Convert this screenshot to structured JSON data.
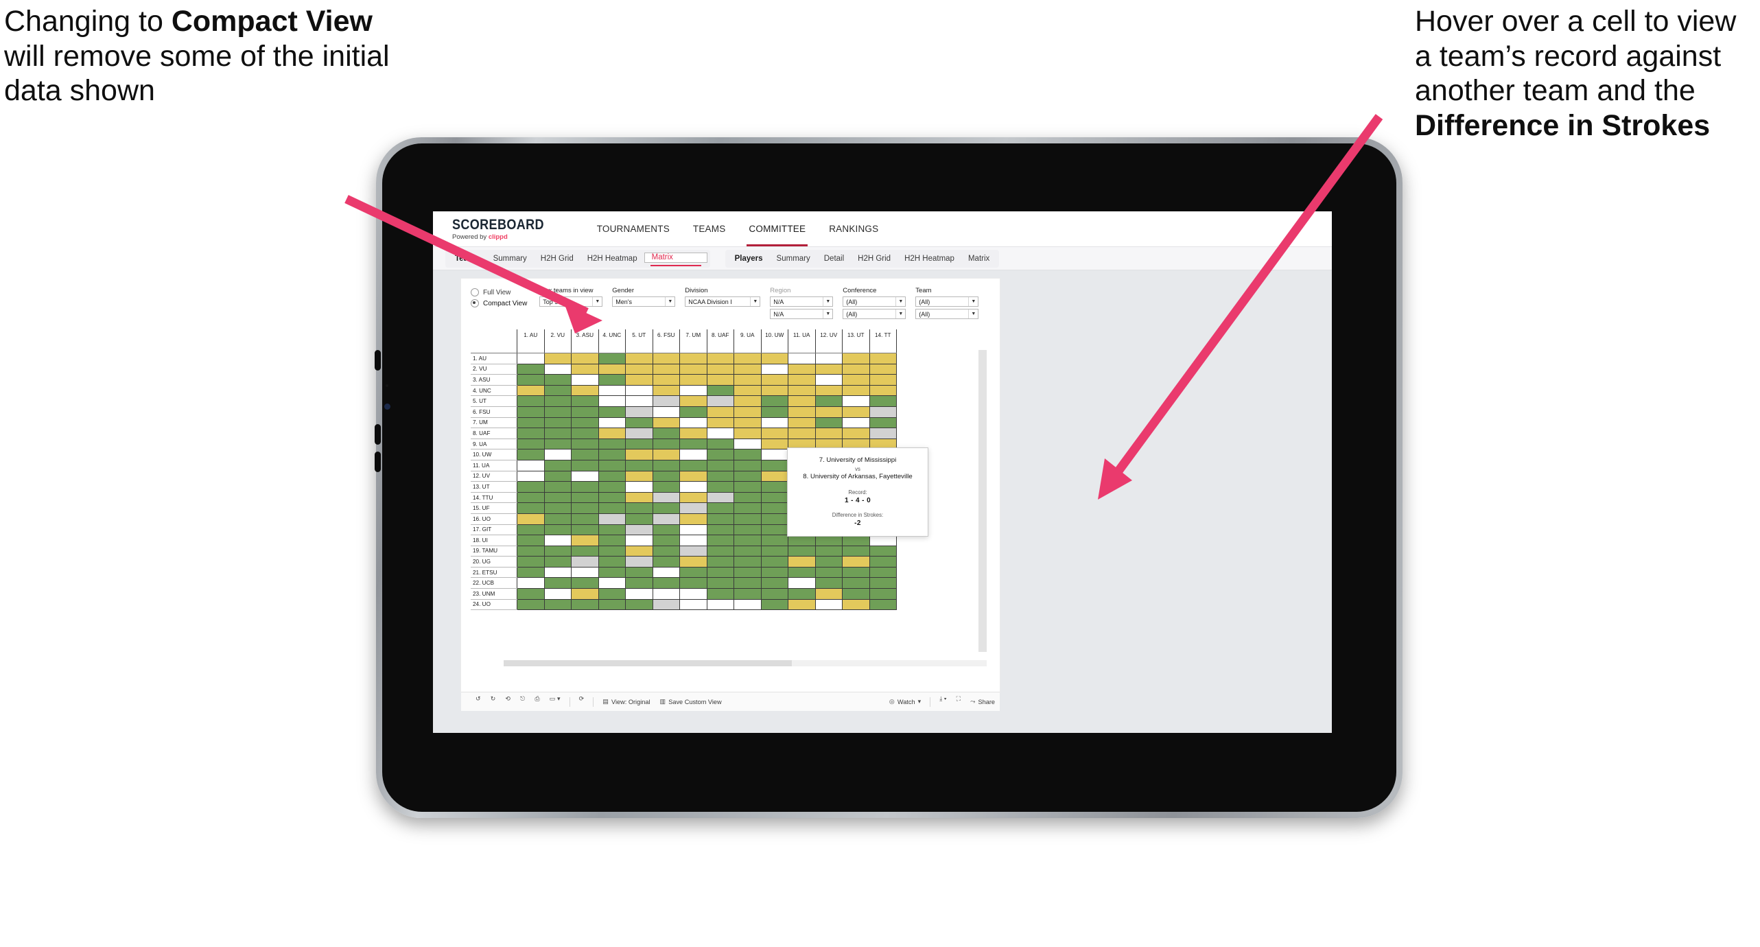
{
  "annotations": {
    "left": {
      "pre": "Changing to ",
      "bold": "Compact View",
      "post": " will remove some of the initial data shown"
    },
    "right": {
      "pre": "Hover over a cell to view a team’s record against another team and the ",
      "bold": "Difference in Strokes",
      "post": ""
    },
    "arrow_color": "#ea3a6d"
  },
  "app": {
    "logo": {
      "main": "SCOREBOARD",
      "powered": "Powered by ",
      "brand": "clippd"
    },
    "topnav": [
      {
        "label": "TOURNAMENTS",
        "active": false
      },
      {
        "label": "TEAMS",
        "active": false
      },
      {
        "label": "COMMITTEE",
        "active": true
      },
      {
        "label": "RANKINGS",
        "active": false
      }
    ],
    "subnav": {
      "teams_group": {
        "heading": "Teams",
        "items": [
          "Summary",
          "H2H Grid",
          "H2H Heatmap",
          "Matrix"
        ],
        "selected": "Matrix"
      },
      "players_group": {
        "heading": "Players",
        "items": [
          "Summary",
          "Detail",
          "H2H Grid",
          "H2H Heatmap",
          "Matrix"
        ],
        "selected": ""
      }
    }
  },
  "filters": {
    "view_mode": {
      "options": [
        "Full View",
        "Compact View"
      ],
      "selected": "Compact View"
    },
    "max_teams": {
      "label": "Max teams in view",
      "value": "Top 50"
    },
    "gender": {
      "label": "Gender",
      "value": "Men's"
    },
    "division": {
      "label": "Division",
      "value": "NCAA Division I"
    },
    "region": {
      "label": "Region",
      "value1": "N/A",
      "value2": "N/A"
    },
    "conference": {
      "label": "Conference",
      "value1": "(All)",
      "value2": "(All)"
    },
    "team": {
      "label": "Team",
      "value1": "(All)",
      "value2": "(All)"
    }
  },
  "matrix": {
    "columns": [
      "1. AU",
      "2. VU",
      "3. ASU",
      "4. UNC",
      "5. UT",
      "6. FSU",
      "7. UM",
      "8. UAF",
      "9. UA",
      "10. UW",
      "11. UA",
      "12. UV",
      "13. UT",
      "14. TT"
    ],
    "rows": [
      "1. AU",
      "2. VU",
      "3. ASU",
      "4. UNC",
      "5. UT",
      "6. FSU",
      "7. UM",
      "8. UAF",
      "9. UA",
      "10. UW",
      "11. UA",
      "12. UV",
      "13. UT",
      "14. TTU",
      "15. UF",
      "16. UO",
      "17. GIT",
      "18. UI",
      "19. TAMU",
      "20. UG",
      "21. ETSU",
      "22. UCB",
      "23. UNM",
      "24. UO"
    ],
    "legend": {
      "win": "#6f9f57",
      "loss": "#e3c95c",
      "none": "#ffffff",
      "tie": "#d2d2d2"
    },
    "cells": [
      [
        "n",
        "y",
        "y",
        "g",
        "y",
        "y",
        "y",
        "y",
        "y",
        "y",
        "w",
        "w",
        "y",
        "y"
      ],
      [
        "g",
        "n",
        "y",
        "y",
        "y",
        "y",
        "y",
        "y",
        "y",
        "w",
        "y",
        "y",
        "y",
        "y"
      ],
      [
        "g",
        "g",
        "n",
        "g",
        "y",
        "y",
        "y",
        "y",
        "y",
        "y",
        "y",
        "w",
        "y",
        "y"
      ],
      [
        "y",
        "g",
        "y",
        "n",
        "w",
        "y",
        "w",
        "g",
        "y",
        "y",
        "y",
        "y",
        "y",
        "y"
      ],
      [
        "g",
        "g",
        "g",
        "w",
        "n",
        "a",
        "y",
        "a",
        "y",
        "g",
        "y",
        "g",
        "w",
        "g"
      ],
      [
        "g",
        "g",
        "g",
        "g",
        "a",
        "n",
        "g",
        "y",
        "y",
        "g",
        "y",
        "y",
        "y",
        "a"
      ],
      [
        "g",
        "g",
        "g",
        "w",
        "g",
        "y",
        "n",
        "y",
        "y",
        "w",
        "y",
        "g",
        "w",
        "g"
      ],
      [
        "g",
        "g",
        "g",
        "y",
        "a",
        "g",
        "y",
        "n",
        "y",
        "y",
        "y",
        "y",
        "y",
        "a"
      ],
      [
        "g",
        "g",
        "g",
        "g",
        "g",
        "g",
        "g",
        "g",
        "n",
        "y",
        "y",
        "y",
        "y",
        "y"
      ],
      [
        "g",
        "w",
        "g",
        "g",
        "y",
        "y",
        "w",
        "g",
        "g",
        "n",
        "y",
        "y",
        "y",
        "w"
      ],
      [
        "w",
        "g",
        "g",
        "g",
        "g",
        "g",
        "g",
        "g",
        "g",
        "g",
        "n",
        "y",
        "g",
        "a"
      ],
      [
        "w",
        "g",
        "w",
        "g",
        "y",
        "g",
        "y",
        "g",
        "g",
        "y",
        "g",
        "n",
        "y",
        "y"
      ],
      [
        "g",
        "g",
        "g",
        "g",
        "w",
        "g",
        "w",
        "g",
        "g",
        "g",
        "g",
        "g",
        "n",
        "g"
      ],
      [
        "g",
        "g",
        "g",
        "g",
        "y",
        "a",
        "y",
        "a",
        "g",
        "g",
        "g",
        "a",
        "y",
        "n"
      ],
      [
        "g",
        "g",
        "g",
        "g",
        "g",
        "g",
        "a",
        "g",
        "g",
        "g",
        "g",
        "g",
        "w",
        "g"
      ],
      [
        "y",
        "g",
        "g",
        "a",
        "g",
        "a",
        "y",
        "g",
        "g",
        "g",
        "g",
        "g",
        "g",
        "g"
      ],
      [
        "g",
        "g",
        "g",
        "g",
        "a",
        "g",
        "w",
        "g",
        "g",
        "g",
        "g",
        "a",
        "g",
        "g"
      ],
      [
        "g",
        "w",
        "y",
        "g",
        "w",
        "g",
        "w",
        "g",
        "g",
        "g",
        "g",
        "g",
        "g",
        "w"
      ],
      [
        "g",
        "g",
        "g",
        "g",
        "y",
        "g",
        "a",
        "g",
        "g",
        "g",
        "g",
        "g",
        "g",
        "g"
      ],
      [
        "g",
        "g",
        "a",
        "g",
        "a",
        "g",
        "y",
        "g",
        "g",
        "g",
        "y",
        "g",
        "y",
        "g"
      ],
      [
        "g",
        "w",
        "w",
        "g",
        "g",
        "w",
        "g",
        "g",
        "g",
        "g",
        "g",
        "g",
        "g",
        "g"
      ],
      [
        "w",
        "g",
        "g",
        "w",
        "g",
        "g",
        "g",
        "g",
        "g",
        "g",
        "w",
        "g",
        "g",
        "g"
      ],
      [
        "g",
        "w",
        "y",
        "g",
        "w",
        "w",
        "w",
        "g",
        "g",
        "g",
        "g",
        "y",
        "g",
        "g"
      ],
      [
        "g",
        "g",
        "g",
        "g",
        "g",
        "a",
        "w",
        "w",
        "w",
        "g",
        "y",
        "w",
        "y",
        "g"
      ]
    ]
  },
  "tooltip": {
    "team_a": "7. University of Mississippi",
    "vs": "vs",
    "team_b": "8. University of Arkansas, Fayetteville",
    "record_label": "Record:",
    "record_value": "1 - 4 - 0",
    "diff_label": "Difference in Strokes:",
    "diff_value": "-2"
  },
  "toolbar": {
    "undo": "undo-icon",
    "redo": "redo-icon",
    "revert": "revert-icon",
    "refresh": "refresh-icon",
    "pause": "pause-icon",
    "view_label": "View: Original",
    "save_label": "Save Custom View",
    "watch_label": "Watch",
    "share_label": "Share"
  }
}
